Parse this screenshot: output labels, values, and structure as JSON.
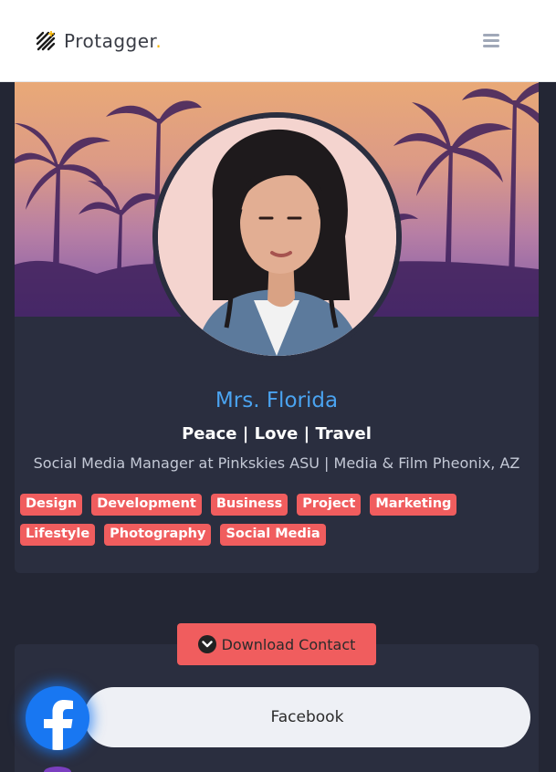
{
  "header": {
    "logo_text": "Protagger",
    "logo_dot": ".",
    "logo_icon": "logo-mark-icon",
    "menu_icon": "hamburger-icon"
  },
  "profile": {
    "name": "Mrs. Florida",
    "tagline": "Peace | Love | Travel",
    "bio": "Social Media Manager at Pinkskies ASU | Media & Film Pheonix, AZ",
    "tags": [
      "Design",
      "Development",
      "Business",
      "Project",
      "Marketing",
      "Lifestyle",
      "Photography",
      "Social Media"
    ]
  },
  "actions": {
    "download_label": "Download Contact",
    "download_icon": "chevron-down-circle-icon"
  },
  "links": [
    {
      "label": "Facebook",
      "icon": "facebook-icon"
    }
  ],
  "colors": {
    "accent": "#f05d5e",
    "name_blue": "#4aa3f0",
    "card_bg": "#2a2e3f",
    "page_bg": "#232634",
    "facebook": "#1877f2"
  }
}
